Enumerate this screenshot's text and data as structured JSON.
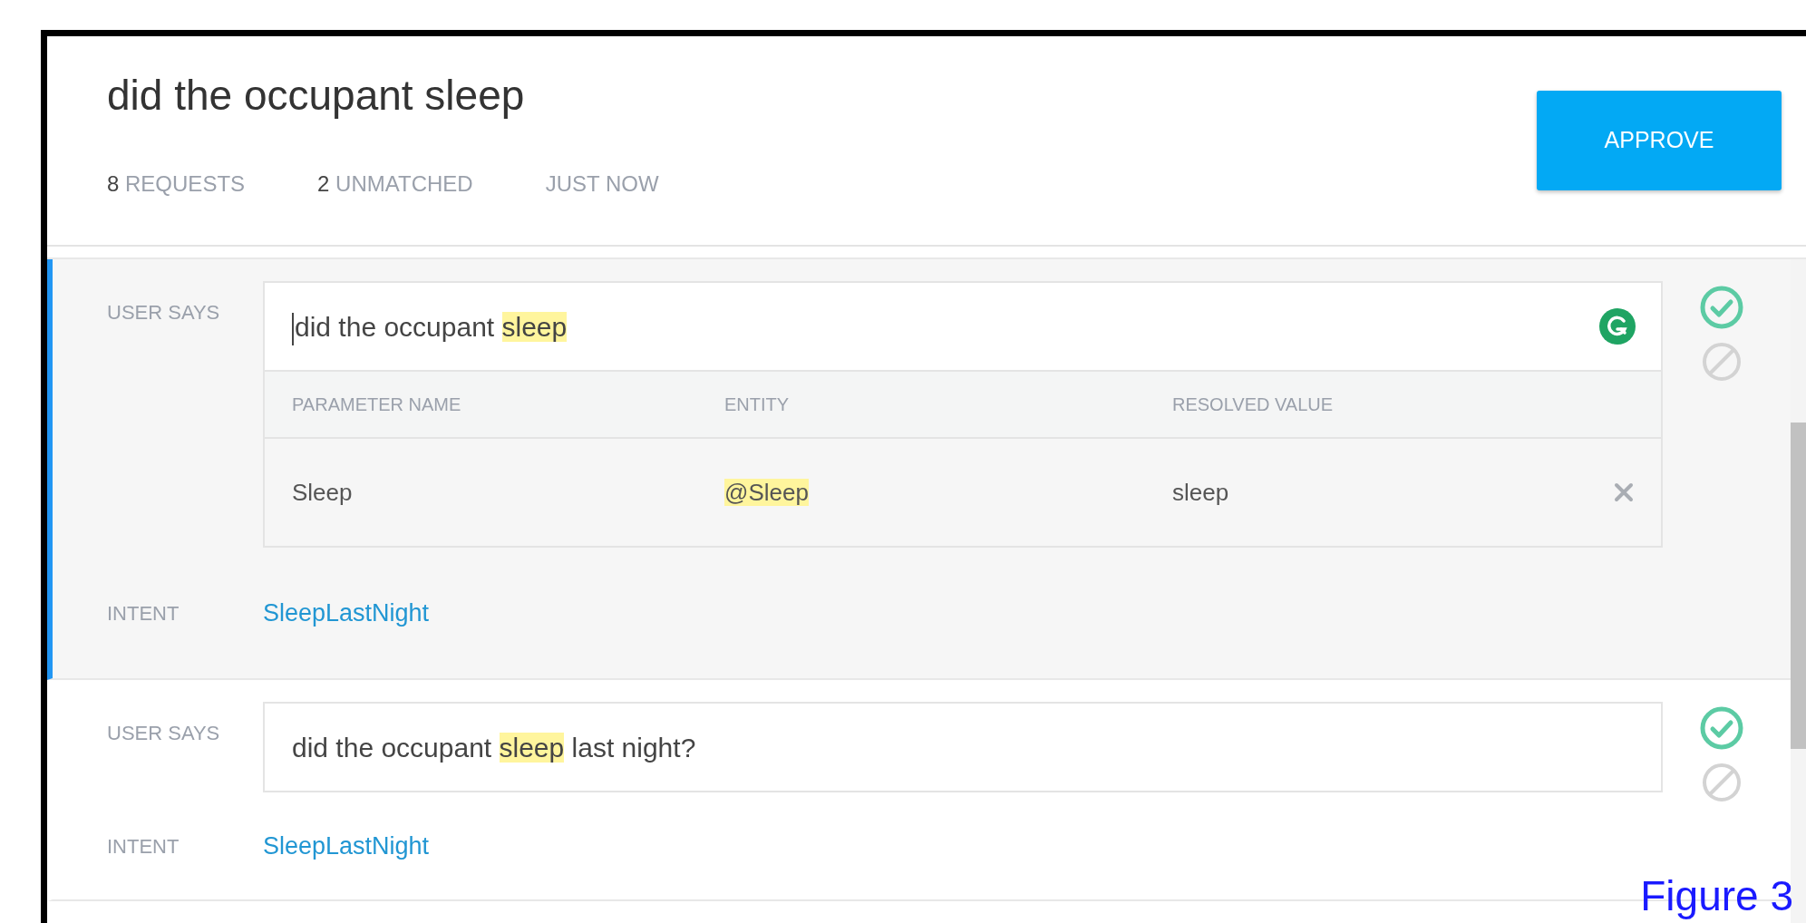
{
  "title": "did the occupant sleep",
  "stats": [
    {
      "count": "8",
      "label": "REQUESTS"
    },
    {
      "count": "2",
      "label": "UNMATCHED"
    },
    {
      "label": "JUST NOW"
    }
  ],
  "approve_button": "APPROVE",
  "requests": [
    {
      "selected": true,
      "focused": true,
      "user_says_label": "USER SAYS",
      "segments": [
        {
          "text": "did the occupant ",
          "highlighted": false
        },
        {
          "text": "sleep",
          "highlighted": true
        }
      ],
      "parameters": {
        "columns": [
          "PARAMETER NAME",
          "ENTITY",
          "RESOLVED VALUE"
        ],
        "rows": [
          {
            "name": "Sleep",
            "entity": "@Sleep",
            "value": "sleep"
          }
        ]
      },
      "intent_label": "INTENT",
      "intent": "SleepLastNight"
    },
    {
      "selected": false,
      "focused": false,
      "user_says_label": "USER SAYS",
      "segments": [
        {
          "text": "did the occupant ",
          "highlighted": false
        },
        {
          "text": "sleep",
          "highlighted": true
        },
        {
          "text": " last night?",
          "highlighted": false
        }
      ],
      "intent_label": "INTENT",
      "intent": "SleepLastNight"
    }
  ],
  "caption": "Figure 3"
}
